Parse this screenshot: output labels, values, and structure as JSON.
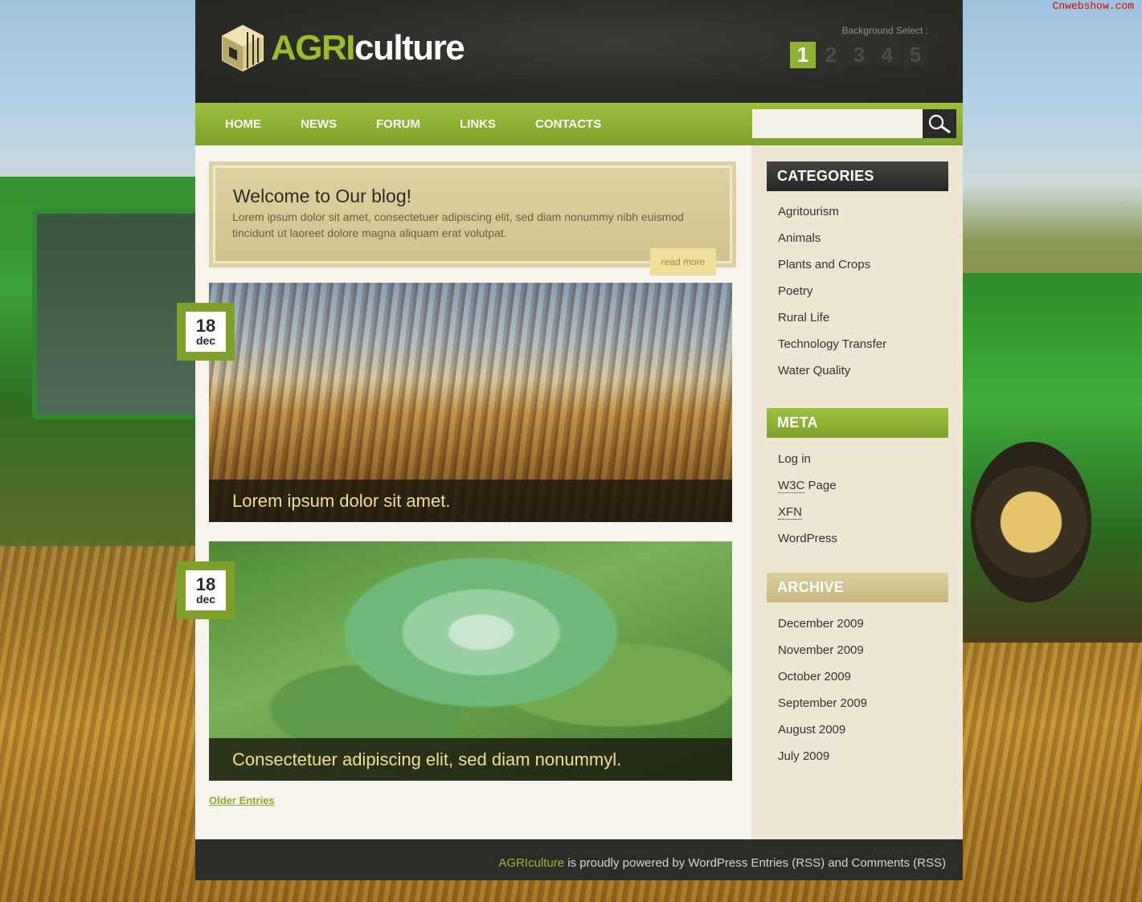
{
  "watermark": "Cnwebshow.com",
  "header": {
    "logo_agri": "AGRI",
    "logo_culture": "culture",
    "bg_select_label": "Background Select :",
    "bg_options": [
      "1",
      "2",
      "3",
      "4",
      "5"
    ],
    "bg_active": "1"
  },
  "nav": {
    "items": [
      "HOME",
      "NEWS",
      "FORUM",
      "LINKS",
      "CONTACTS"
    ]
  },
  "search": {
    "placeholder": "",
    "icon": "magnifier-icon"
  },
  "welcome": {
    "title": "Welcome to Our blog!",
    "body": "Lorem ipsum dolor sit amet, consectetuer adipiscing elit, sed diam nonummy nibh euismod tincidunt ut laoreet dolore magna aliquam erat volutpat.",
    "read_more": "read more"
  },
  "posts": [
    {
      "day": "18",
      "month": "dec",
      "caption": "Lorem ipsum dolor sit amet."
    },
    {
      "day": "18",
      "month": "dec",
      "caption": "Consectetuer adipiscing elit, sed diam nonummyl."
    }
  ],
  "older_entries": "Older Entries",
  "sidebar": {
    "categories": {
      "title": "CATEGORIES",
      "items": [
        "Agritourism",
        "Animals",
        "Plants and Crops",
        "Poetry",
        "Rural Life",
        "Technology Transfer",
        "Water Quality"
      ]
    },
    "meta": {
      "title": "META",
      "items": [
        "Log in",
        "W3C",
        "Page",
        "XFN",
        "WordPress"
      ]
    },
    "archive": {
      "title": "ARCHIVE",
      "items": [
        "December 2009",
        "November 2009",
        "October 2009",
        "September 2009",
        "August 2009",
        "July 2009"
      ]
    }
  },
  "footer": {
    "brand": "AGRIculture",
    "text": " is proudly powered by WordPress Entries (RSS) and Comments (RSS)"
  },
  "colors": {
    "accent_green": "#8fb131",
    "dark": "#2a2a27",
    "tan": "#d2c28e",
    "caption_text": "#f2dd95"
  }
}
